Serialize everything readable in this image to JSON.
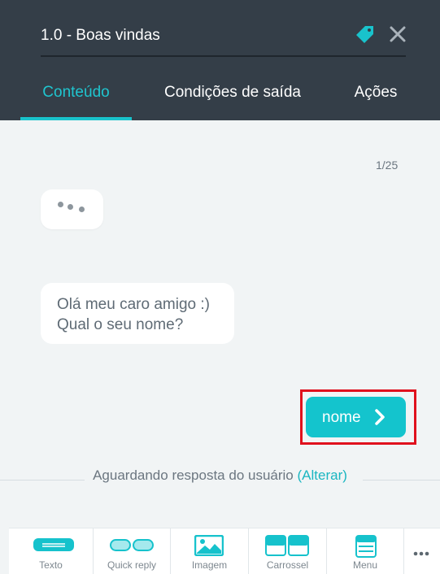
{
  "header": {
    "title": "1.0 - Boas vindas",
    "icons": {
      "tag": "tag-icon",
      "close": "close-icon"
    },
    "tabs": [
      {
        "label": "Conteúdo",
        "active": true
      },
      {
        "label": "Condições de saída",
        "active": false
      },
      {
        "label": "Ações",
        "active": false
      }
    ]
  },
  "content": {
    "counter": "1/25",
    "typing_indicator_icon": "typing-dots-icon",
    "message": {
      "line1": "Olá meu caro amigo :)",
      "line2": "Qual o seu nome?"
    },
    "reply_button": {
      "label": "nome",
      "icon": "chevron-right-icon"
    },
    "status": {
      "text": "Aguardando resposta do usuário",
      "link": "(Alterar)"
    }
  },
  "toolbar": {
    "items": [
      {
        "label": "Texto",
        "icon": "text-block-icon"
      },
      {
        "label": "Quick reply",
        "icon": "quick-reply-icon"
      },
      {
        "label": "Imagem",
        "icon": "image-icon"
      },
      {
        "label": "Carrossel",
        "icon": "carousel-icon"
      },
      {
        "label": "Menu",
        "icon": "menu-icon"
      }
    ],
    "more_icon": "more-horizontal-icon"
  },
  "colors": {
    "header_bg": "#343e48",
    "accent": "#14c4cd",
    "highlight": "#e0111d",
    "canvas_bg": "#f1f4f5"
  }
}
